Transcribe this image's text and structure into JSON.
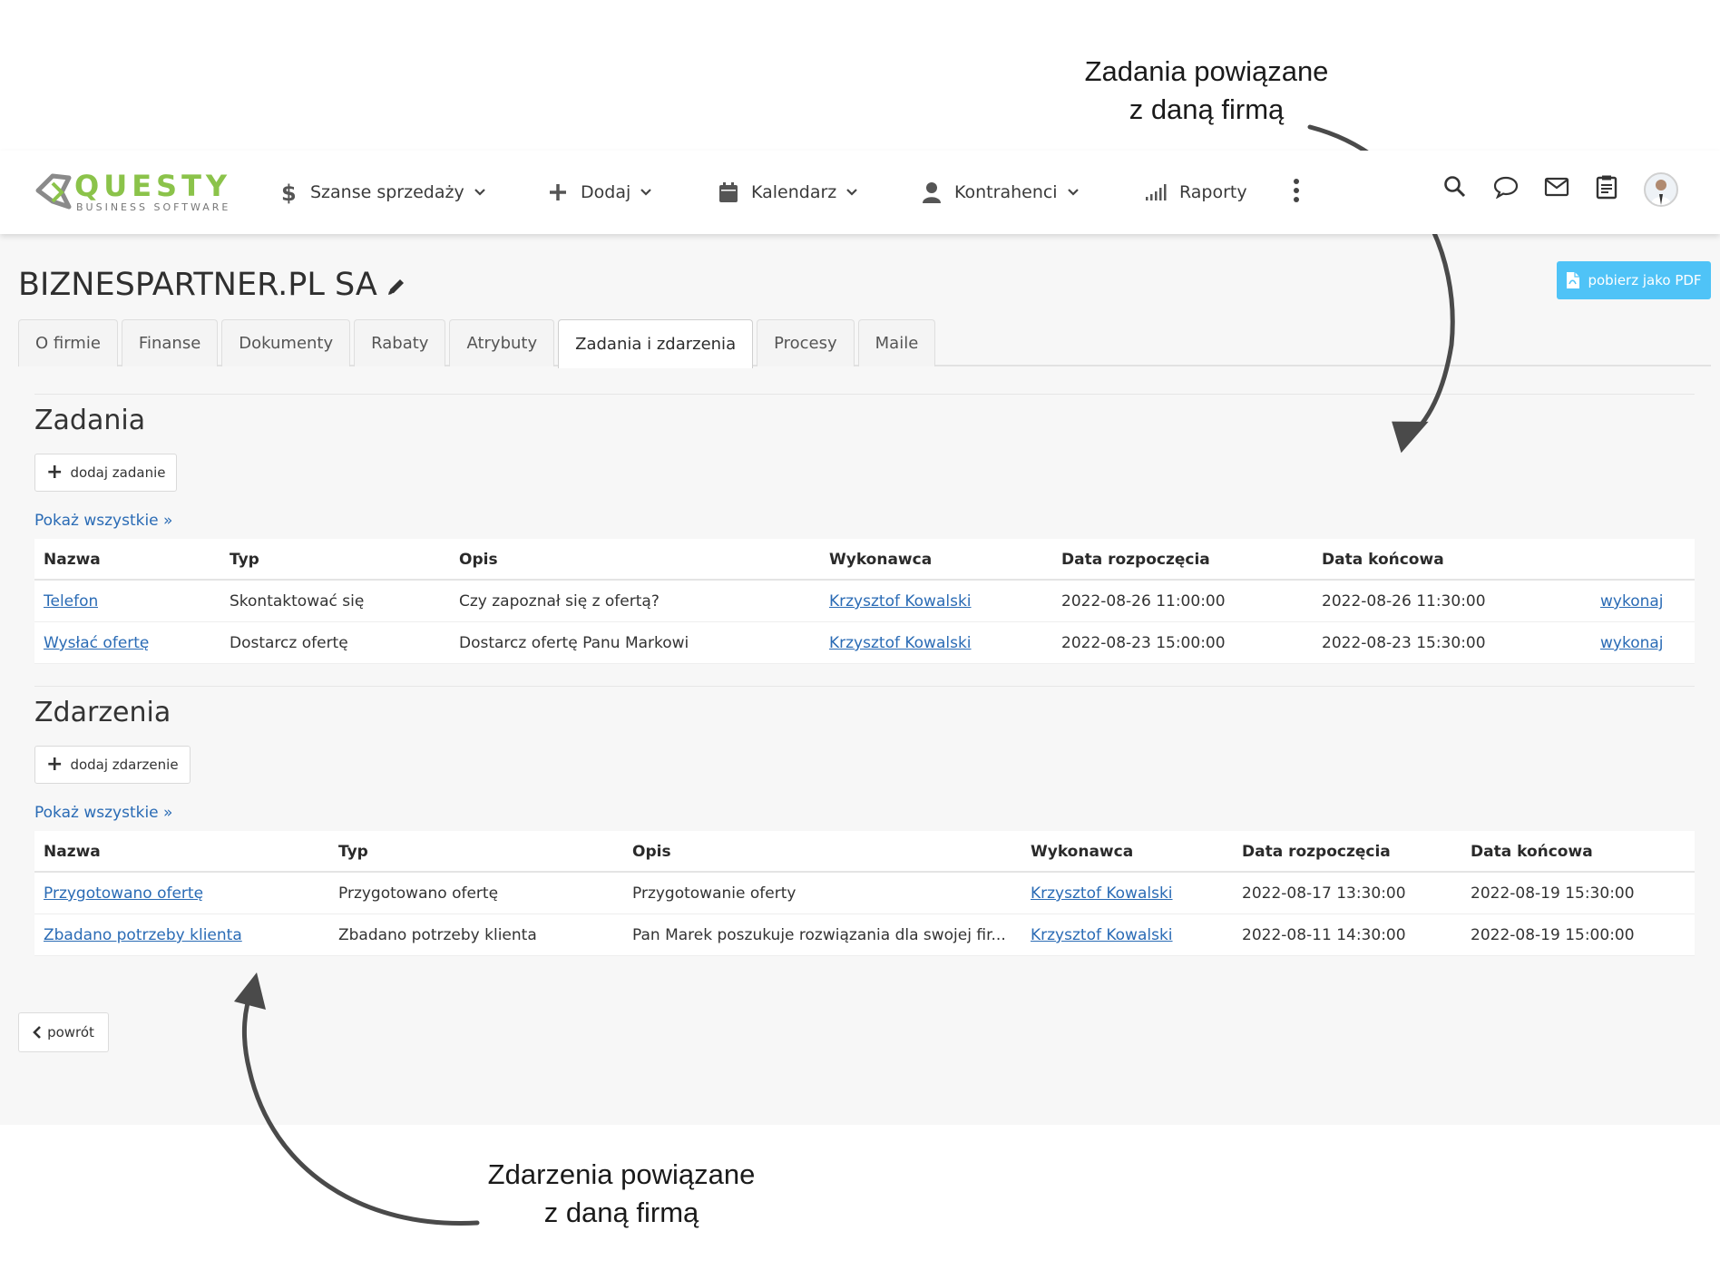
{
  "annotations": {
    "top_line1": "Zadania powiązane",
    "top_line2": "z daną firmą",
    "bottom_line1": "Zdarzenia powiązane",
    "bottom_line2": "z daną firmą"
  },
  "logo": {
    "word": "QUESTY",
    "sub": "BUSINESS SOFTWARE"
  },
  "nav": {
    "items": [
      {
        "label": "Szanse sprzedaży",
        "icon": "dollar-icon"
      },
      {
        "label": "Dodaj",
        "icon": "plus-icon"
      },
      {
        "label": "Kalendarz",
        "icon": "calendar-icon"
      },
      {
        "label": "Kontrahenci",
        "icon": "user-icon"
      },
      {
        "label": "Raporty",
        "icon": "signal-icon"
      }
    ],
    "right_icons": [
      "search-icon",
      "chat-icon",
      "mail-icon",
      "clipboard-icon",
      "avatar"
    ]
  },
  "page": {
    "title": "BIZNESPARTNER.PL SA",
    "pdf_button": "pobierz jako PDF",
    "tabs": [
      "O firmie",
      "Finanse",
      "Dokumenty",
      "Rabaty",
      "Atrybuty",
      "Zadania i zdarzenia",
      "Procesy",
      "Maile"
    ],
    "active_tab": "Zadania i zdarzenia",
    "back_label": "powrót"
  },
  "tasks": {
    "title": "Zadania",
    "add_label": "dodaj zadanie",
    "show_all": "Pokaż wszystkie »",
    "headers": [
      "Nazwa",
      "Typ",
      "Opis",
      "Wykonawca",
      "Data rozpoczęcia",
      "Data końcowa"
    ],
    "rows": [
      {
        "name": "Telefon",
        "type": "Skontaktować się",
        "desc": "Czy zapoznał się z ofertą?",
        "exec": "Krzysztof Kowalski",
        "start": "2022-08-26 11:00:00",
        "end": "2022-08-26 11:30:00",
        "action": "wykonaj"
      },
      {
        "name": "Wysłać ofertę",
        "type": "Dostarcz ofertę",
        "desc": "Dostarcz ofertę Panu Markowi",
        "exec": "Krzysztof Kowalski",
        "start": "2022-08-23 15:00:00",
        "end": "2022-08-23 15:30:00",
        "action": "wykonaj"
      }
    ]
  },
  "events": {
    "title": "Zdarzenia",
    "add_label": "dodaj zdarzenie",
    "show_all": "Pokaż wszystkie »",
    "headers": [
      "Nazwa",
      "Typ",
      "Opis",
      "Wykonawca",
      "Data rozpoczęcia",
      "Data końcowa"
    ],
    "rows": [
      {
        "name": "Przygotowano ofertę",
        "type": "Przygotowano ofertę",
        "desc": "Przygotowanie oferty",
        "exec": "Krzysztof Kowalski",
        "start": "2022-08-17 13:30:00",
        "end": "2022-08-19 15:30:00"
      },
      {
        "name": "Zbadano potrzeby klienta",
        "type": "Zbadano potrzeby klienta",
        "desc": "Pan Marek poszukuje rozwiązania dla swojej fir...",
        "exec": "Krzysztof Kowalski",
        "start": "2022-08-11 14:30:00",
        "end": "2022-08-19 15:00:00"
      }
    ]
  },
  "colors": {
    "brand_green": "#8bc34a",
    "pdf_button": "#4fc3f7",
    "link": "#2a6bb5"
  }
}
